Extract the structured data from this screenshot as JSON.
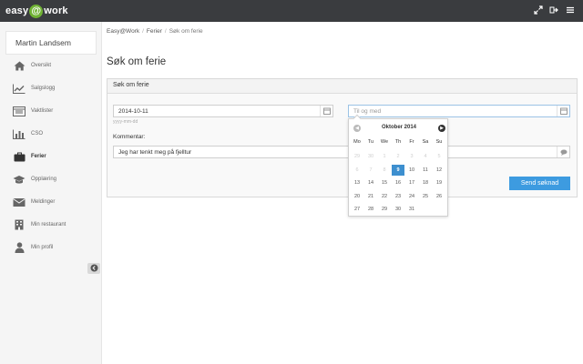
{
  "app": {
    "logo_left": "easy",
    "logo_at": "@",
    "logo_right": "work",
    "icons": [
      "expand-icon",
      "logout-icon",
      "menu-icon"
    ],
    "accent_color": "#6fb233",
    "topbar_color": "#3a3c3f"
  },
  "sidebar": {
    "user_name": "Martin Landsem",
    "items": [
      {
        "label": "Oversikt",
        "icon": "home-icon"
      },
      {
        "label": "Salgslogg",
        "icon": "chart-line-icon"
      },
      {
        "label": "Vaktlister",
        "icon": "calendar-list-icon"
      },
      {
        "label": "CSO",
        "icon": "bar-chart-icon"
      },
      {
        "label": "Ferier",
        "icon": "suitcase-icon"
      },
      {
        "label": "Opplæring",
        "icon": "graduation-cap-icon"
      },
      {
        "label": "Meldinger",
        "icon": "envelope-icon"
      },
      {
        "label": "Min restaurant",
        "icon": "building-icon"
      },
      {
        "label": "Min profil",
        "icon": "user-icon"
      }
    ],
    "active_index": 4
  },
  "breadcrumb": [
    "Easy@Work",
    "Ferier",
    "Søk om ferie"
  ],
  "page_title": "Søk om ferie",
  "form": {
    "panel_title": "Søk om ferie",
    "from_date": "2014-10-11",
    "from_hint": "yyyy-mm-dd",
    "to_placeholder": "Til og med",
    "comment_label": "Kommentar:",
    "comment_value": "Jeg har tenkt meg på fjelltur",
    "submit_label": "Send søknad",
    "submit_color": "#3d9be0"
  },
  "datepicker": {
    "month_label": "Oktober 2014",
    "weekdays": [
      "Mo",
      "Tu",
      "We",
      "Th",
      "Fr",
      "Sa",
      "Su"
    ],
    "weeks": [
      [
        "29",
        "30",
        "1",
        "2",
        "3",
        "4",
        "5"
      ],
      [
        "6",
        "7",
        "8",
        "9",
        "10",
        "11",
        "12"
      ],
      [
        "13",
        "14",
        "15",
        "16",
        "17",
        "18",
        "19"
      ],
      [
        "20",
        "21",
        "22",
        "23",
        "24",
        "25",
        "26"
      ],
      [
        "27",
        "28",
        "29",
        "30",
        "31",
        "",
        ""
      ]
    ],
    "disabled_through": "9",
    "selected": "9",
    "selected_color": "#3d8fcf"
  }
}
